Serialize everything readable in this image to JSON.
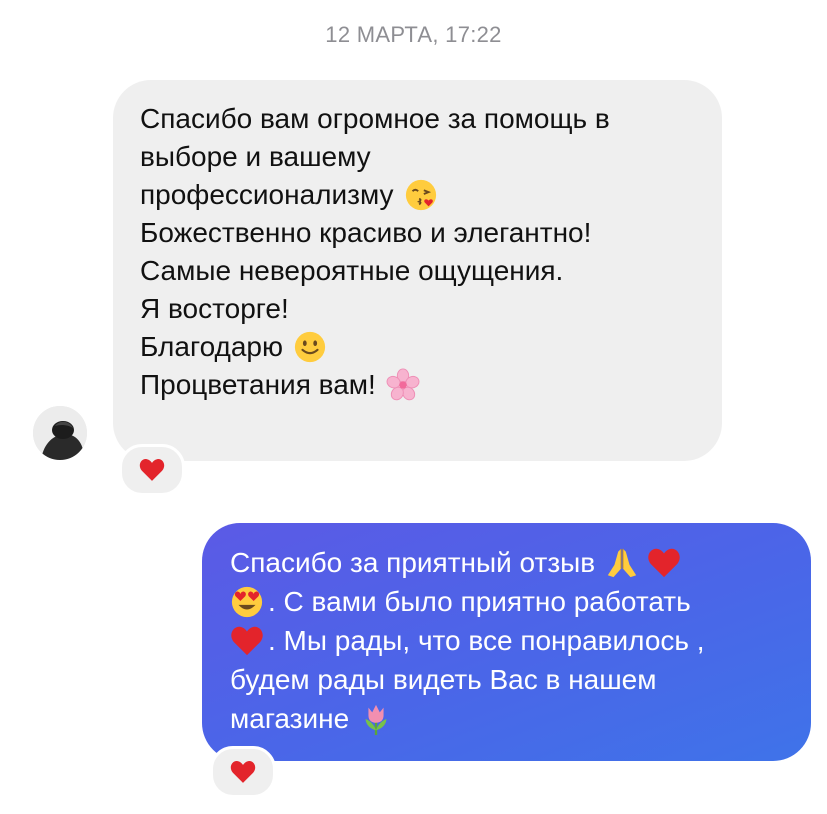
{
  "timestamp": "12 МАРТА, 17:22",
  "incoming": {
    "lines": [
      "Спасибо вам огромное за помощь в",
      "выборе и вашему",
      "профессионализму",
      "Божественно красиво и элегантно!",
      "Самые невероятные ощущения.",
      "Я восторге!",
      "Благодарю",
      "Процветания вам!"
    ],
    "emojis": [
      "kissing-face-emoji",
      "slightly-smiling-face-emoji",
      "cherry-blossom-emoji"
    ],
    "reaction": "red-heart"
  },
  "outgoing": {
    "lines": [
      "Спасибо за приятный отзыв",
      ". С вами было приятно работать",
      ". Мы рады, что все понравилось ,",
      "будем рады видеть Вас в нашем",
      "магазине"
    ],
    "emojis": [
      "folded-hands-emoji",
      "red-heart-emoji",
      "heart-eyes-emoji",
      "red-heart-emoji",
      "tulip-emoji"
    ],
    "reaction": "red-heart"
  },
  "colors": {
    "incoming_bubble": "#efefef",
    "outgoing_bubble_start": "#5b5ae6",
    "outgoing_bubble_end": "#3f73e9",
    "timestamp": "#8e8e93",
    "heart": "#e3242b"
  }
}
